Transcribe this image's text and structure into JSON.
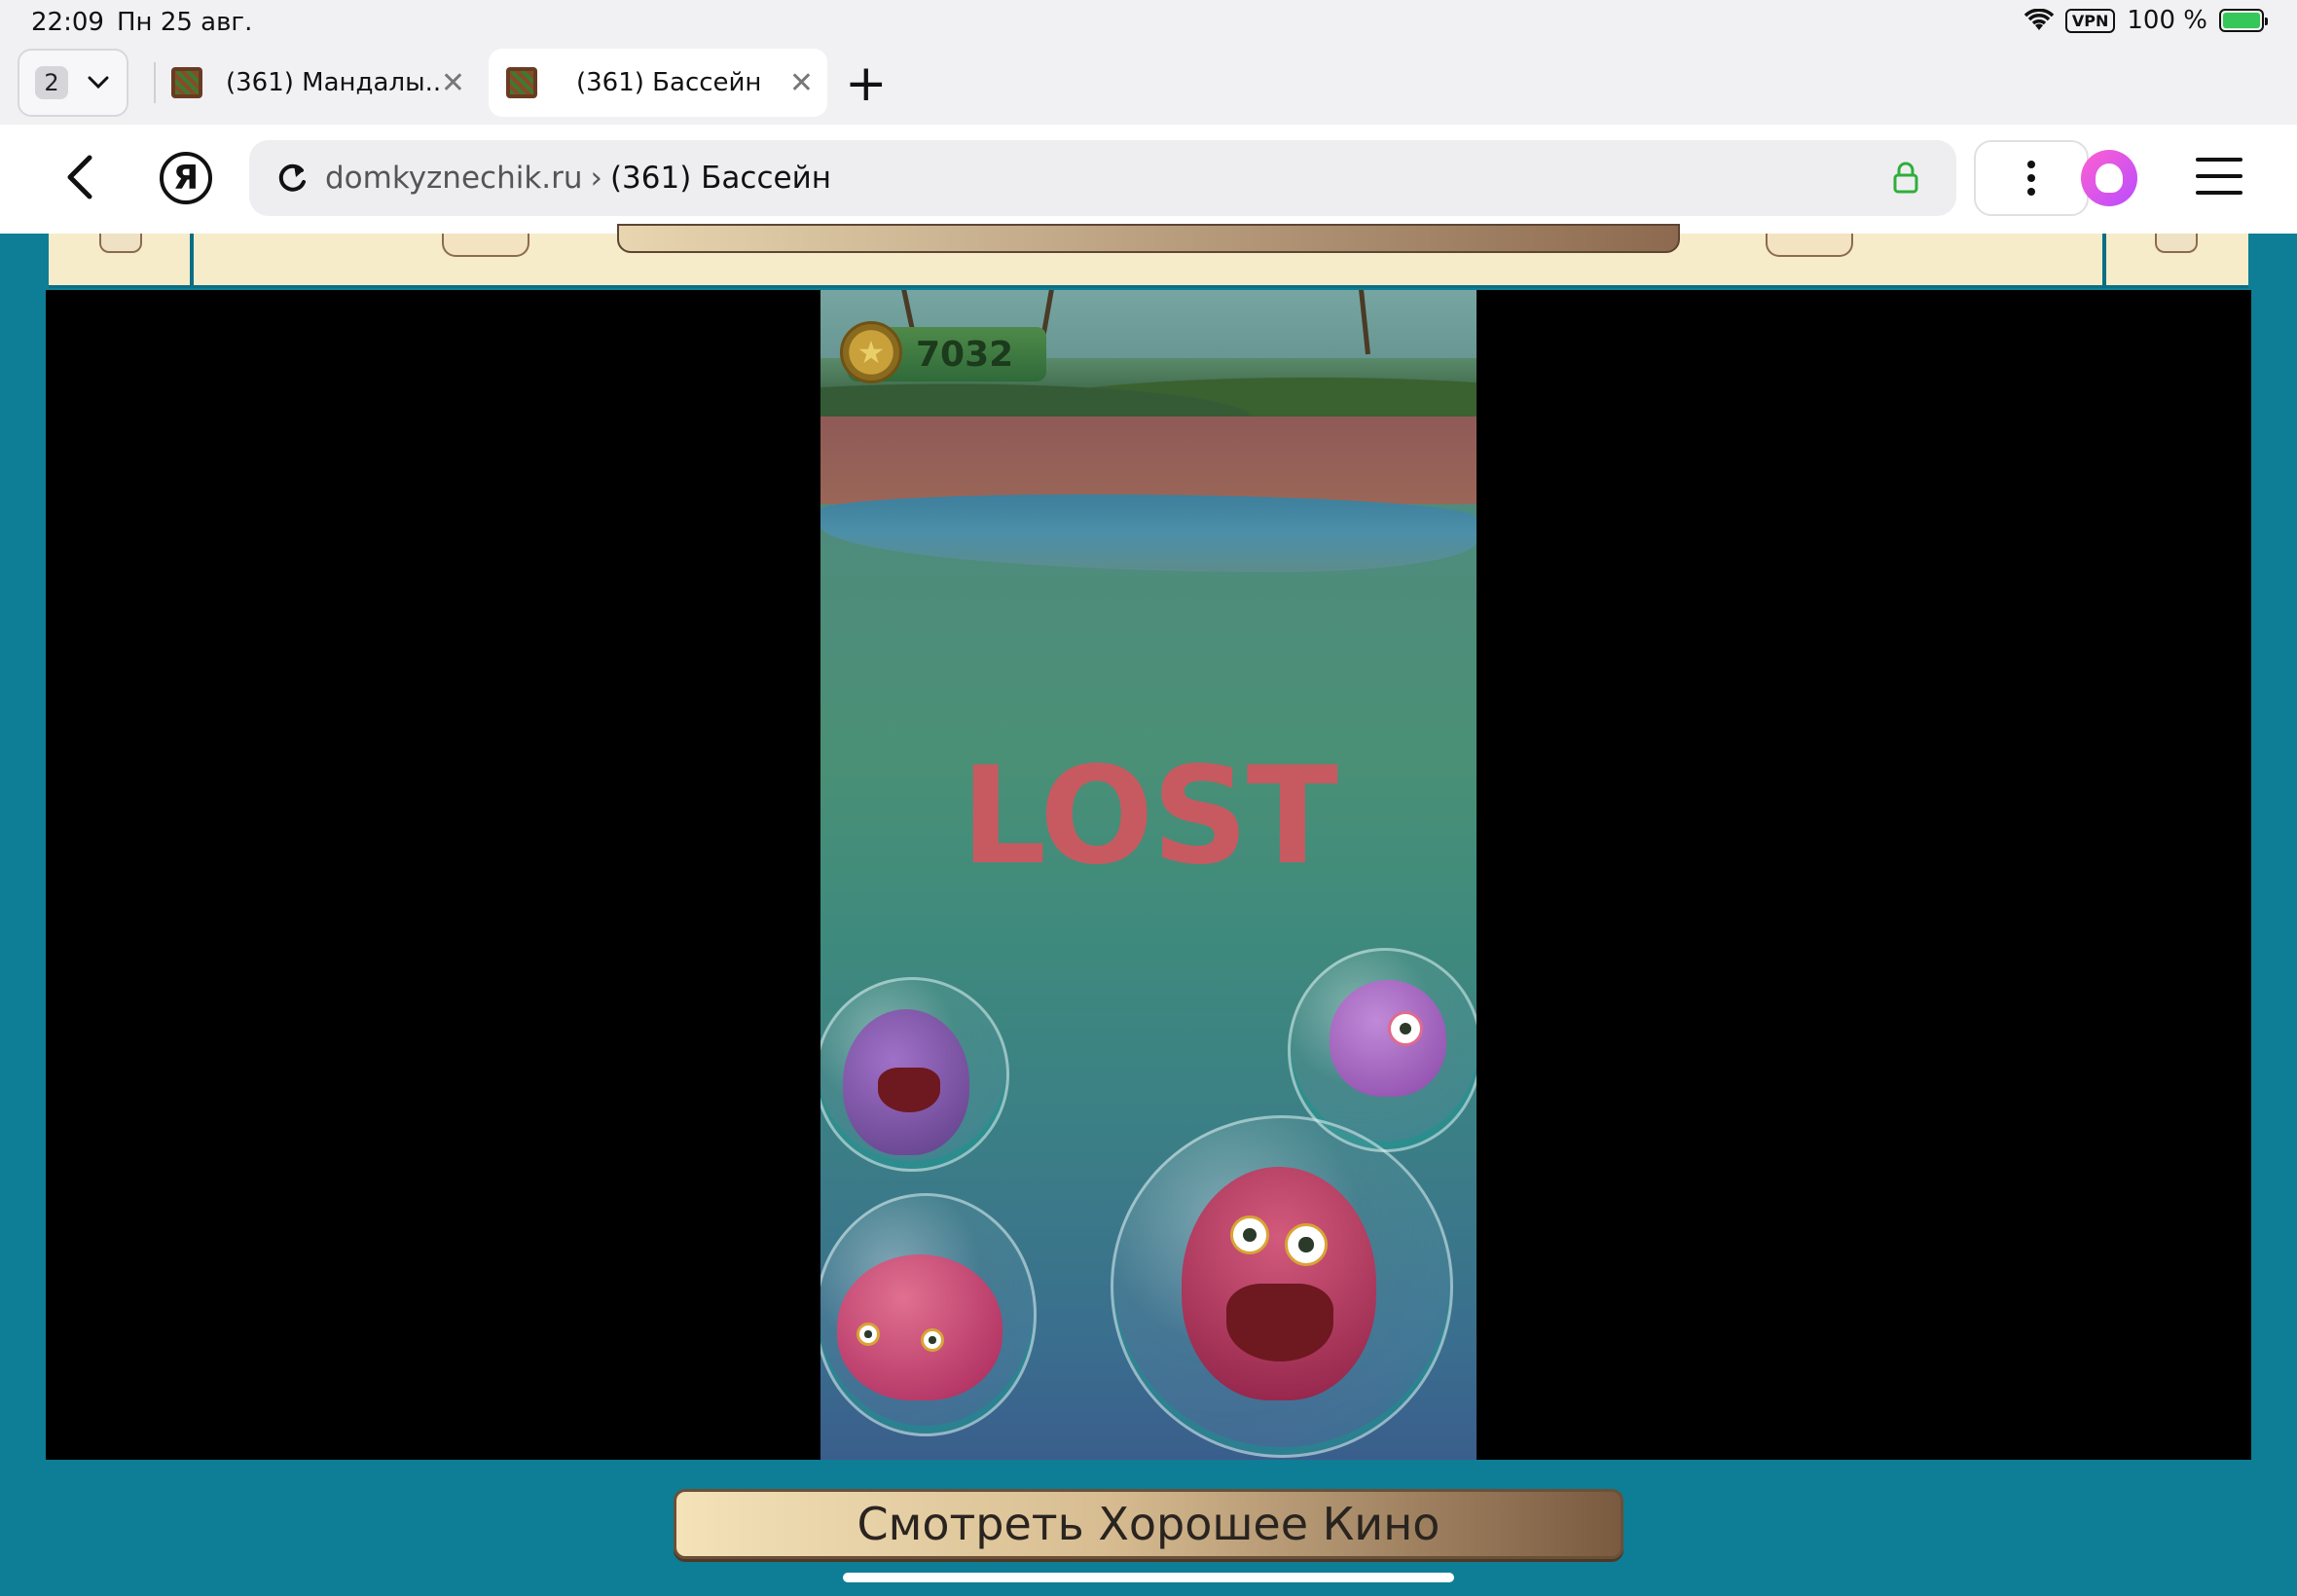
{
  "status_bar": {
    "time": "22:09",
    "date": "Пн 25 авг.",
    "vpn": "VPN",
    "battery": "100 %"
  },
  "tabs": {
    "count": "2",
    "items": [
      {
        "title": "(361) Мандалы..."
      },
      {
        "title": "(361) Бассейн"
      }
    ]
  },
  "address_bar": {
    "domain": "domkyznechik.ru",
    "separator": "›",
    "page_title": "(361) Бассейн"
  },
  "game": {
    "coins": "7032",
    "result": "LOST"
  },
  "page": {
    "bottom_button_label": "Смотреть Хорошее Кино"
  },
  "colors": {
    "page_background": "#0d7e95",
    "lost_text": "#c75a60",
    "battery_fill": "#35c759"
  }
}
